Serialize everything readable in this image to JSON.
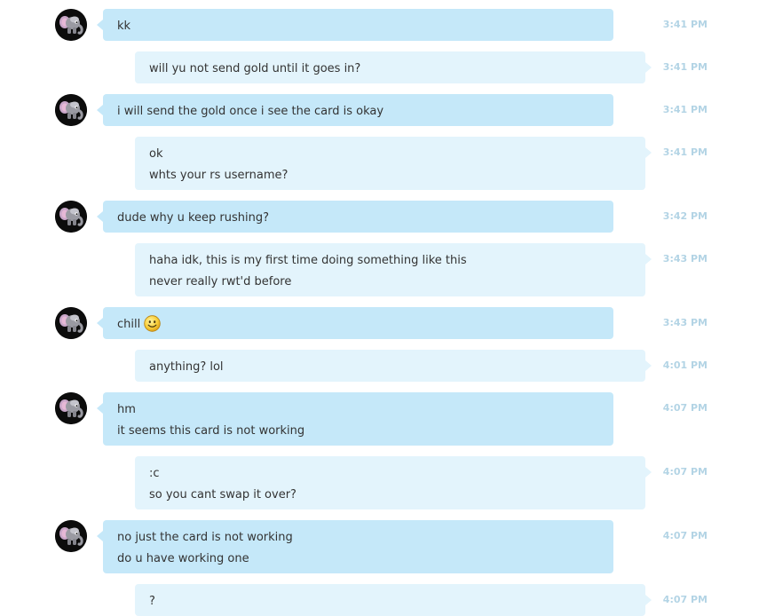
{
  "messages": [
    {
      "side": "in",
      "lines": [
        "kk"
      ],
      "time": "3:41 PM"
    },
    {
      "side": "out",
      "lines": [
        "will yu not send gold until it goes in?"
      ],
      "time": "3:41 PM"
    },
    {
      "side": "in",
      "lines": [
        "i will send the gold once i see the card is okay"
      ],
      "time": "3:41 PM"
    },
    {
      "side": "out",
      "lines": [
        "ok",
        "whts your rs username?"
      ],
      "time": "3:41 PM"
    },
    {
      "side": "in",
      "lines": [
        "dude why u keep rushing?"
      ],
      "time": "3:42 PM"
    },
    {
      "side": "out",
      "lines": [
        "haha idk, this is my first time doing something like this",
        "never really rwt'd before"
      ],
      "time": "3:43 PM"
    },
    {
      "side": "in",
      "lines": [
        "chill"
      ],
      "time": "3:43 PM",
      "emoji": "smiley-emoji"
    },
    {
      "side": "out",
      "lines": [
        "anything? lol"
      ],
      "time": "4:01 PM"
    },
    {
      "side": "in",
      "lines": [
        "hm",
        "it seems this card is not working"
      ],
      "time": "4:07 PM"
    },
    {
      "side": "out",
      "lines": [
        ":c",
        "so you cant swap it over?"
      ],
      "time": "4:07 PM"
    },
    {
      "side": "in",
      "lines": [
        "no just the card is not working",
        "do u have working one"
      ],
      "time": "4:07 PM"
    },
    {
      "side": "out",
      "lines": [
        "?"
      ],
      "time": "4:07 PM"
    }
  ],
  "avatar_icon": "elephant-avatar-icon",
  "colors": {
    "incoming_bubble": "#c5e8f9",
    "outgoing_bubble": "#e3f4fc",
    "timestamp": "#b3d4e5",
    "text": "#333333"
  }
}
